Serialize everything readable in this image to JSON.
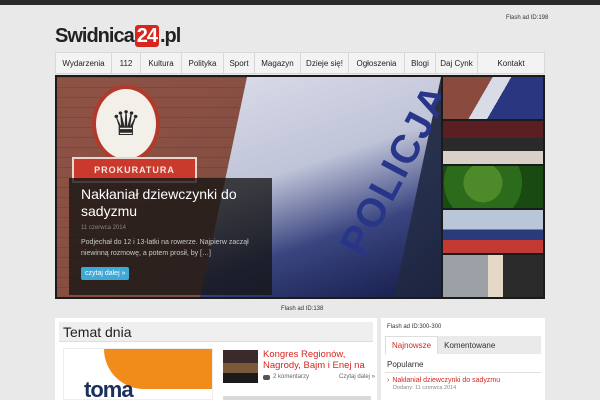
{
  "header": {
    "logo_part1": "Swidnica",
    "logo_part2": "24",
    "logo_part3": ".pl",
    "flash_ad_top": "Flash ad ID:198"
  },
  "nav": {
    "items": [
      "Wydarzenia",
      "112",
      "Kultura",
      "Polityka",
      "Sport",
      "Magazyn",
      "Dzieje się!",
      "Ogłoszenia",
      "Blogi",
      "Daj Cynk",
      "Kontakt"
    ]
  },
  "slider": {
    "plaque_text": "PROKURATURA",
    "van_text": "POLICJA",
    "title": "Nakłaniał dziewczynki do sadyzmu",
    "date": "11 czerwca 2014",
    "excerpt": "Podjechał do 12 i 13-latki na rowerze. Najpierw zaczął niewinną rozmowę, a potem prosił, by […]",
    "read_more": "czytaj dalej »"
  },
  "flash_ad_mid": "Flash ad ID:138",
  "main": {
    "section_title": "Temat dnia",
    "promo_text": "toma",
    "article_title": "Kongres Regionów, Nagrody, Bajm i Enej na",
    "article_comments": "2 komentarzy",
    "article_more": "Czytaj dalej »"
  },
  "sidebar": {
    "flash_ad": "Flash ad ID:300-300",
    "tabs": [
      "Najnowsze",
      "Komentowane"
    ],
    "popular_heading": "Popularne",
    "popular_item_title": "Nakłaniał dziewczynki do sadyzmu",
    "popular_item_meta": "Dodany: 11 czerwca 2014"
  },
  "colors": {
    "accent": "#d7261e",
    "button": "#3fa9d6",
    "topbar": "#2a2a2a"
  }
}
